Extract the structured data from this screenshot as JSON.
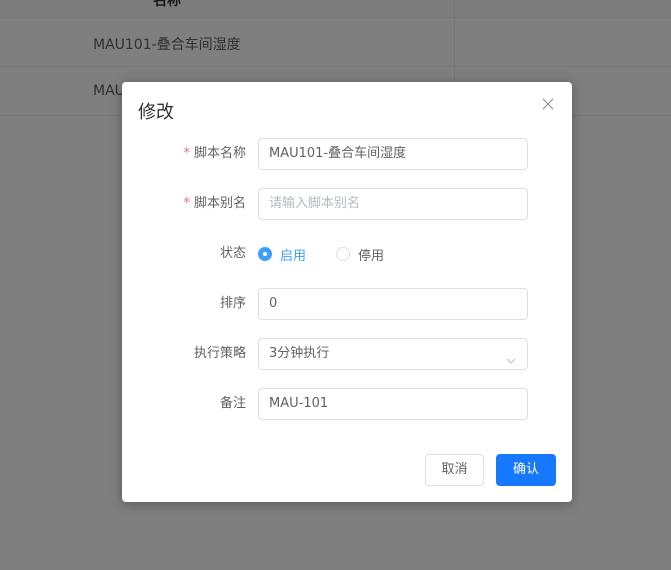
{
  "background_table": {
    "header_label": "名称",
    "rows": [
      {
        "name": "MAU101-叠合车间湿度"
      },
      {
        "name": "MAU"
      }
    ]
  },
  "dialog": {
    "title": "修改",
    "close_icon": "close-icon",
    "fields": {
      "script_name": {
        "label": "脚本名称",
        "required": true,
        "value": "MAU101-叠合车间湿度"
      },
      "script_alias": {
        "label": "脚本别名",
        "required": true,
        "value": "",
        "placeholder": "请输入脚本别名"
      },
      "status": {
        "label": "状态",
        "options": [
          "启用",
          "停用"
        ],
        "selected": "启用"
      },
      "sort": {
        "label": "排序",
        "value": "0"
      },
      "strategy": {
        "label": "执行策略",
        "value": "3分钟执行",
        "icon": "chevron-down-icon"
      },
      "remark": {
        "label": "备注",
        "value": "MAU-101"
      }
    },
    "buttons": {
      "cancel": "取消",
      "confirm": "确认"
    }
  },
  "colors": {
    "primary": "#1677ff",
    "radio_active": "#409eff",
    "required": "#f56c6c",
    "mask": "rgba(0,0,0,0.5)"
  }
}
